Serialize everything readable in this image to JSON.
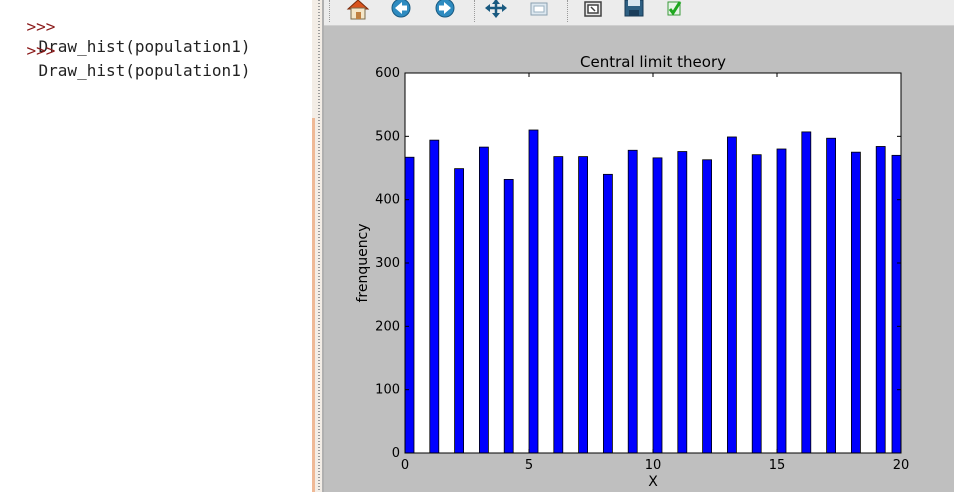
{
  "console": {
    "lines": [
      {
        "prompt": ">>>",
        "command": "Draw_hist(population1)"
      },
      {
        "prompt": ">>>",
        "command": "Draw_hist(population1)"
      }
    ]
  },
  "toolbar": {
    "buttons": [
      {
        "icon": "home-icon"
      },
      {
        "icon": "back-arrow-icon"
      },
      {
        "icon": "forward-arrow-icon"
      },
      {
        "icon": "pan-icon"
      },
      {
        "icon": "zoom-rect-icon"
      },
      {
        "icon": "configure-subplots-icon"
      },
      {
        "icon": "save-icon"
      },
      {
        "icon": "edit-axis-icon"
      }
    ]
  },
  "colors": {
    "bar_fill": "#0000ff",
    "bar_edge": "#000000",
    "figure_bg": "#bfbfbf",
    "axes_bg": "#ffffff"
  },
  "chart_data": {
    "type": "bar",
    "title": "Central limit theory",
    "xlabel": "X",
    "ylabel": "frenquency",
    "xlim": [
      0,
      20
    ],
    "ylim": [
      0,
      600
    ],
    "xticks": [
      "0",
      "5",
      "10",
      "15",
      "20"
    ],
    "yticks": [
      "0",
      "100",
      "200",
      "300",
      "400",
      "500",
      "600"
    ],
    "grid": false,
    "bars": [
      {
        "x": 0.0,
        "value": 467
      },
      {
        "x": 1.0,
        "value": 494
      },
      {
        "x": 2.0,
        "value": 449
      },
      {
        "x": 3.0,
        "value": 483
      },
      {
        "x": 4.0,
        "value": 432
      },
      {
        "x": 5.0,
        "value": 510
      },
      {
        "x": 6.0,
        "value": 468
      },
      {
        "x": 7.0,
        "value": 468
      },
      {
        "x": 8.0,
        "value": 440
      },
      {
        "x": 9.0,
        "value": 478
      },
      {
        "x": 10.0,
        "value": 466
      },
      {
        "x": 11.0,
        "value": 476
      },
      {
        "x": 12.0,
        "value": 463
      },
      {
        "x": 13.0,
        "value": 499
      },
      {
        "x": 14.0,
        "value": 471
      },
      {
        "x": 15.0,
        "value": 480
      },
      {
        "x": 16.0,
        "value": 507
      },
      {
        "x": 17.0,
        "value": 497
      },
      {
        "x": 18.0,
        "value": 475
      },
      {
        "x": 19.0,
        "value": 484
      },
      {
        "x": 20.0,
        "value": 470
      }
    ]
  }
}
